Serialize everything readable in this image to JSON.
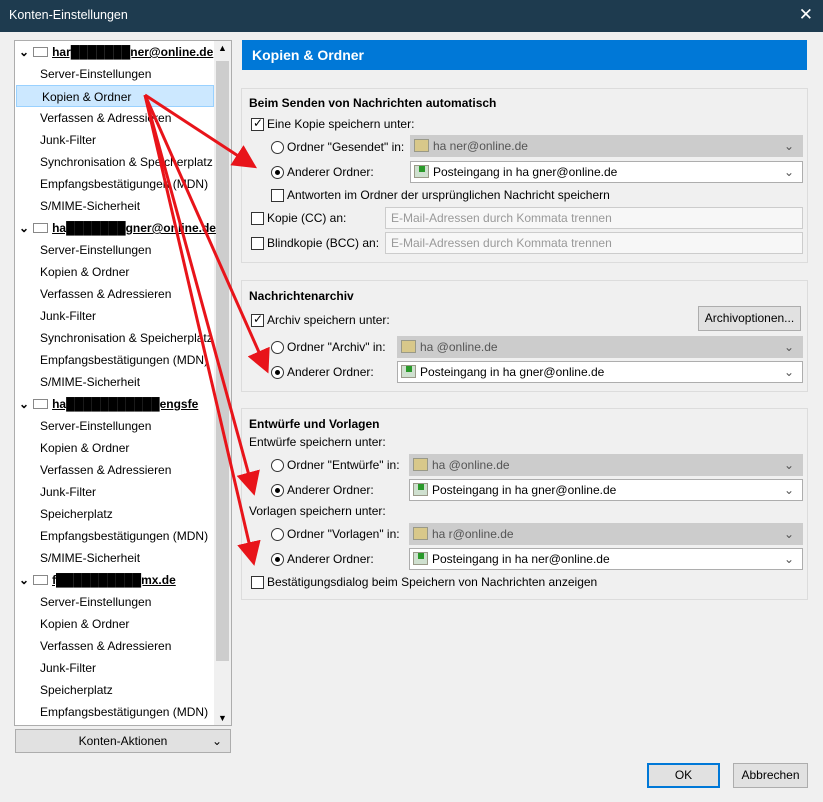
{
  "window": {
    "title": "Konten-Einstellungen",
    "close": "✕"
  },
  "tree": {
    "accounts": [
      {
        "name": "har███████ner@online.de",
        "items": [
          "Server-Einstellungen",
          "Kopien & Ordner",
          "Verfassen & Adressieren",
          "Junk-Filter",
          "Synchronisation & Speicherplatz",
          "Empfangsbestätigungen (MDN)",
          "S/MIME-Sicherheit"
        ]
      },
      {
        "name": "ha███████gner@online.de",
        "items": [
          "Server-Einstellungen",
          "Kopien & Ordner",
          "Verfassen & Adressieren",
          "Junk-Filter",
          "Synchronisation & Speicherplatz",
          "Empfangsbestätigungen (MDN)",
          "S/MIME-Sicherheit"
        ]
      },
      {
        "name": "ha███████████engsfe",
        "items": [
          "Server-Einstellungen",
          "Kopien & Ordner",
          "Verfassen & Adressieren",
          "Junk-Filter",
          "Speicherplatz",
          "Empfangsbestätigungen (MDN)",
          "S/MIME-Sicherheit"
        ]
      },
      {
        "name": "f██████████mx.de",
        "items": [
          "Server-Einstellungen",
          "Kopien & Ordner",
          "Verfassen & Adressieren",
          "Junk-Filter",
          "Speicherplatz",
          "Empfangsbestätigungen (MDN)"
        ]
      }
    ],
    "selected": "Kopien & Ordner",
    "actions": "Konten-Aktionen"
  },
  "header": "Kopien & Ordner",
  "send": {
    "title": "Beim Senden von Nachrichten automatisch",
    "save_copy": "Eine Kopie speichern unter:",
    "sent_folder": "Ordner \"Gesendet\" in:",
    "sent_value": "ha          ner@online.de",
    "other": "Anderer Ordner:",
    "other_value": "Posteingang in ha          gner@online.de",
    "replies": "Antworten im Ordner der ursprünglichen Nachricht speichern",
    "cc": "Kopie (CC) an:",
    "bcc": "Blindkopie (BCC) an:",
    "placeholder": "E-Mail-Adressen durch Kommata trennen"
  },
  "archive": {
    "title": "Nachrichtenarchiv",
    "save": "Archiv speichern unter:",
    "options": "Archivoptionen...",
    "folder": "Ordner \"Archiv\" in:",
    "folder_value": "ha          @online.de",
    "other": "Anderer Ordner:",
    "other_value": "Posteingang in ha          gner@online.de"
  },
  "drafts": {
    "title": "Entwürfe und Vorlagen",
    "drafts_label": "Entwürfe speichern unter:",
    "drafts_folder": "Ordner \"Entwürfe\" in:",
    "drafts_value": "ha          @online.de",
    "other": "Anderer Ordner:",
    "drafts_other_value": "Posteingang in ha          gner@online.de",
    "templates_label": "Vorlagen speichern unter:",
    "templates_folder": "Ordner \"Vorlagen\" in:",
    "templates_value": "ha          r@online.de",
    "templates_other_value": "Posteingang in ha          ner@online.de",
    "confirm": "Bestätigungsdialog beim Speichern von Nachrichten anzeigen"
  },
  "buttons": {
    "ok": "OK",
    "cancel": "Abbrechen"
  },
  "colors": {
    "accent": "#0078d7",
    "titlebar": "#1e3b4f",
    "annotation": "#e8141a"
  }
}
